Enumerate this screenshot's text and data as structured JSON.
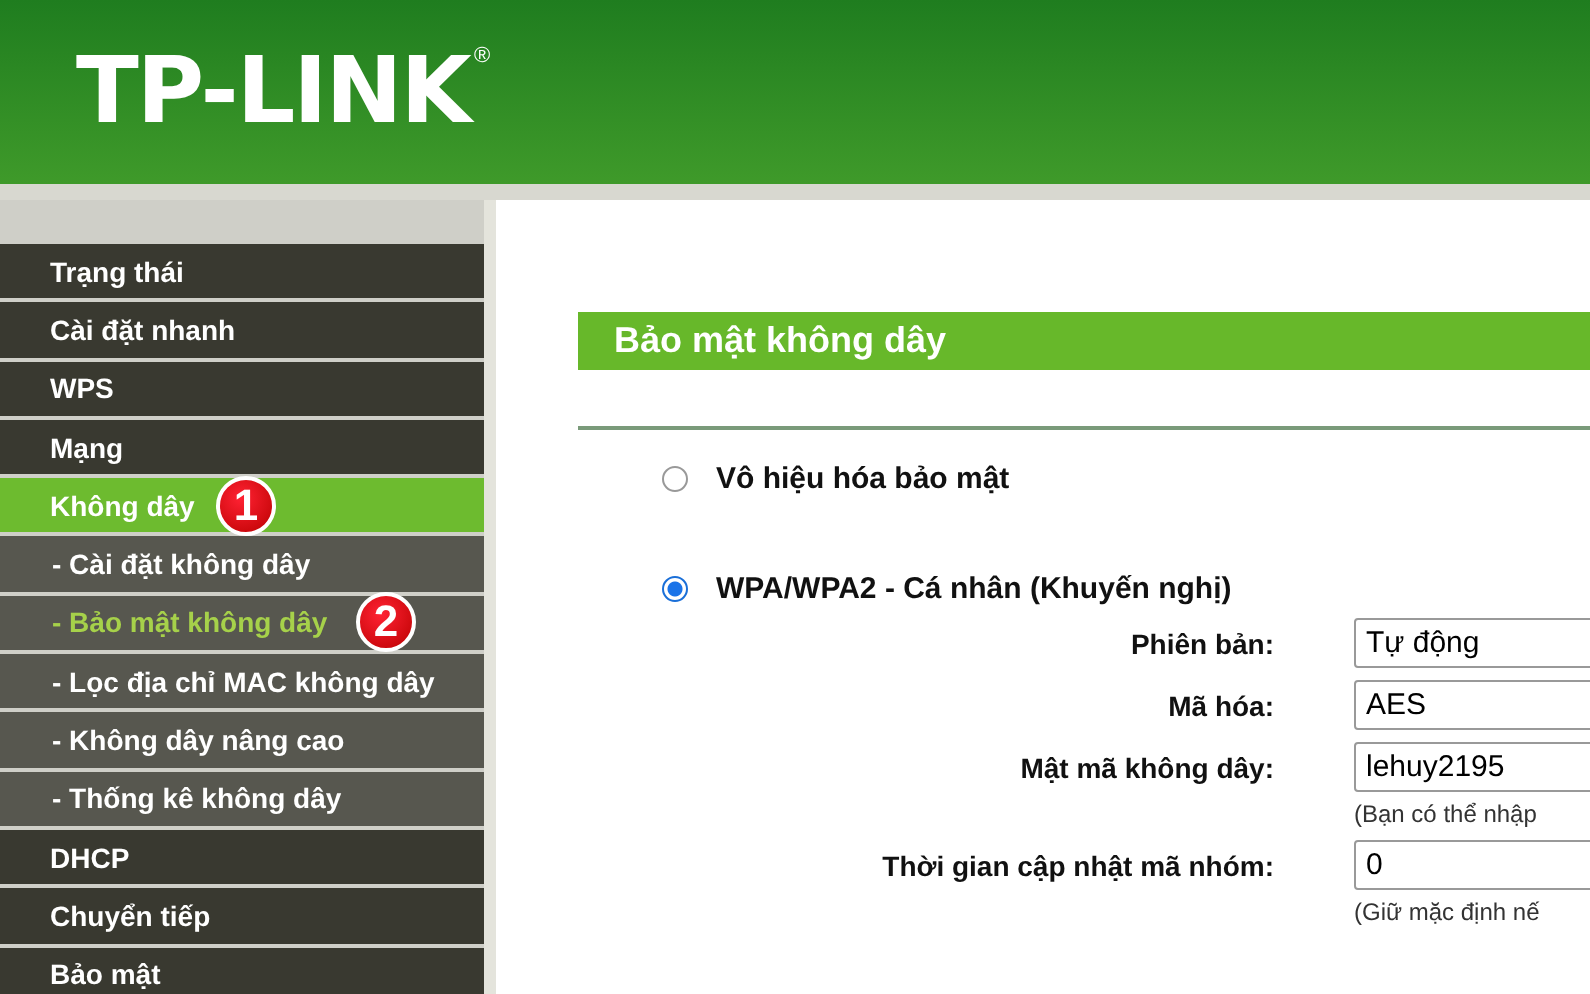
{
  "header": {
    "logo": "TP-LINK",
    "logo_mark": "®"
  },
  "sidebar": {
    "items": [
      {
        "label": "Trạng thái",
        "kind": "main",
        "selected": false
      },
      {
        "label": "Cài đặt nhanh",
        "kind": "main",
        "selected": false
      },
      {
        "label": "WPS",
        "kind": "main",
        "selected": false
      },
      {
        "label": "Mạng",
        "kind": "main",
        "selected": false
      },
      {
        "label": "Không dây",
        "kind": "main",
        "selected": true,
        "badge": "1"
      },
      {
        "label": "- Cài đặt không dây",
        "kind": "sub",
        "selected": false
      },
      {
        "label": "- Bảo mật không dây",
        "kind": "sub",
        "selected": true,
        "badge": "2"
      },
      {
        "label": "- Lọc địa chỉ MAC không dây",
        "kind": "sub",
        "selected": false
      },
      {
        "label": "- Không dây nâng cao",
        "kind": "sub",
        "selected": false
      },
      {
        "label": "- Thống kê không dây",
        "kind": "sub",
        "selected": false
      },
      {
        "label": "DHCP",
        "kind": "main",
        "selected": false
      },
      {
        "label": "Chuyển tiếp",
        "kind": "main",
        "selected": false
      },
      {
        "label": "Bảo mật",
        "kind": "main",
        "selected": false
      }
    ]
  },
  "content": {
    "title": "Bảo mật không dây",
    "options": [
      {
        "label": "Vô hiệu hóa bảo mật",
        "selected": false
      },
      {
        "label": "WPA/WPA2 - Cá nhân (Khuyến nghị)",
        "selected": true
      }
    ],
    "fields": [
      {
        "label": "Phiên bản:",
        "value": "Tự động"
      },
      {
        "label": "Mã hóa:",
        "value": "AES"
      },
      {
        "label": "Mật mã không dây:",
        "value": "lehuy2195",
        "hint": "(Bạn có thể nhập"
      },
      {
        "label": "Thời gian cập nhật mã nhóm:",
        "value": "0",
        "hint": "(Giữ mặc định nế"
      }
    ]
  }
}
